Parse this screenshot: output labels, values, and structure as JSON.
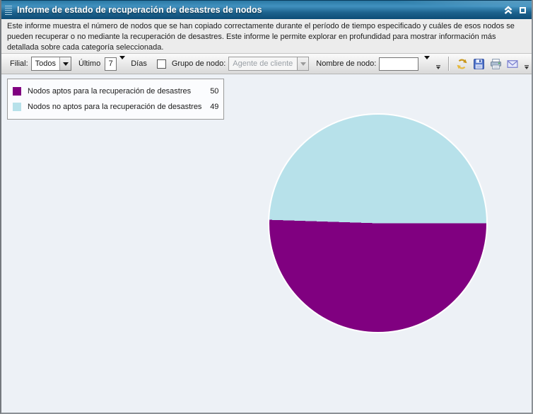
{
  "window": {
    "title": "Informe de estado de recuperación de desastres de nodos"
  },
  "description": {
    "text": "Este informe muestra el número de nodos que se han copiado correctamente durante el período de tiempo especificado y cuáles de esos nodos se pueden recuperar o no mediante la recuperación de desastres. Este informe le permite explorar en profundidad para mostrar información más detallada sobre cada categoría seleccionada."
  },
  "toolbar": {
    "filial_label": "Filial:",
    "filial_value": "Todos",
    "last_label": "Último",
    "days_value": "7",
    "days_label": "Días",
    "node_group_label": "Grupo de nodo:",
    "node_group_value": "Agente de cliente",
    "node_name_label": "Nombre de nodo:",
    "node_name_value": ""
  },
  "legend": {
    "items": [
      {
        "label": "Nodos aptos para la recuperación de desastres",
        "value": "50",
        "color": "#800080"
      },
      {
        "label": "Nodos no aptos para la recuperación de desastres",
        "value": "49",
        "color": "#b7e1ea"
      }
    ]
  },
  "chart_data": {
    "type": "pie",
    "title": "Informe de estado de recuperación de desastres de nodos",
    "labels": [
      "Nodos aptos para la recuperación de desastres",
      "Nodos no aptos para la recuperación de desastres"
    ],
    "values": [
      50,
      49
    ],
    "colors": [
      "#800080",
      "#b7e1ea"
    ],
    "total": 99,
    "start_angle_deg": 90,
    "legend_position": "top-left"
  },
  "colors": {
    "titlebar_blue": "#2c7aa5",
    "content_background": "#edf1f6",
    "slice_eligible": "#800080",
    "slice_not_eligible": "#b7e1ea"
  }
}
